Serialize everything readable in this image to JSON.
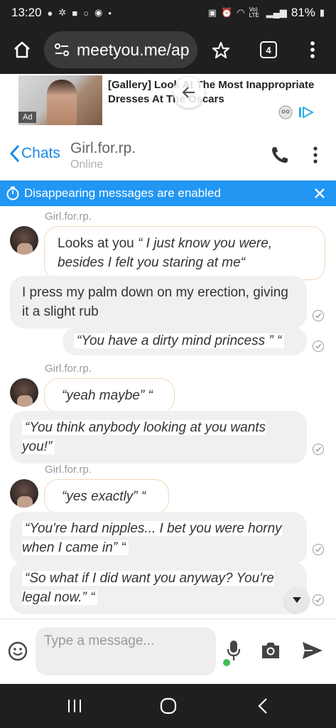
{
  "status_bar": {
    "time": "13:20",
    "battery": "81%",
    "bullet": "•",
    "lte_label": "Vo) LTE"
  },
  "browser": {
    "url": "meetyou.me/ap",
    "tab_count": "4"
  },
  "ad": {
    "title": "[Gallery] Look At The Most Inappropriate Dresses At The Oscars",
    "label": "Ad"
  },
  "chat_header": {
    "back_label": "Chats",
    "contact_name": "Girl.for.rp.",
    "contact_status": "Online"
  },
  "banner": {
    "text": "Disappearing messages are enabled"
  },
  "messages": [
    {
      "type": "sender",
      "text": "Girl.for.rp."
    },
    {
      "type": "incoming",
      "plain": "Looks at you ",
      "italic": "“ I just know you were, besides I felt you staring at me“"
    },
    {
      "type": "outgoing",
      "text": "I press my palm down on my erection, giving it a slight rub"
    },
    {
      "type": "outgoing",
      "text": "“You have a dirty mind princess ” “"
    },
    {
      "type": "sender",
      "text": "Girl.for.rp."
    },
    {
      "type": "incoming",
      "italic": "“yeah maybe” “"
    },
    {
      "type": "outgoing",
      "text": "“You think anybody looking at you wants you!”"
    },
    {
      "type": "sender",
      "text": "Girl.for.rp."
    },
    {
      "type": "incoming",
      "italic": "“yes exactly” “"
    },
    {
      "type": "outgoing",
      "text": "“You're hard nipples... I bet you were horny when I came in” “"
    },
    {
      "type": "outgoing",
      "text": "“So what if I did want you anyway? You're legal now.” “"
    }
  ],
  "composer": {
    "placeholder": "Type a message..."
  },
  "colors": {
    "accent": "#2196f3",
    "link": "#1a8ae5",
    "incoming_border": "#f0d9b9",
    "outgoing_bg": "#f0f0f0"
  }
}
